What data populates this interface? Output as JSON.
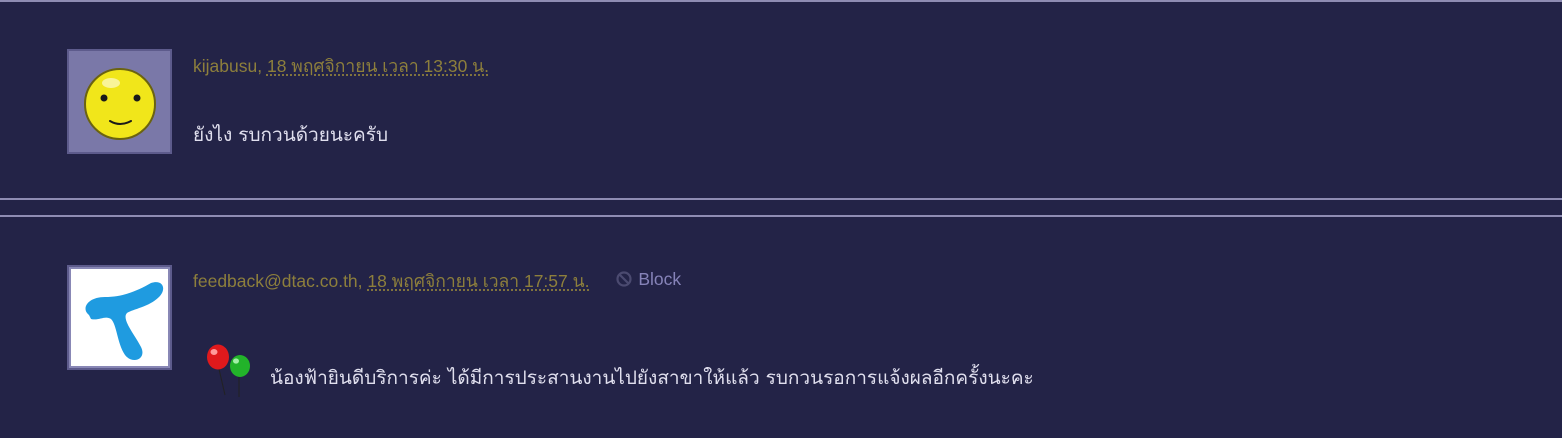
{
  "comments": [
    {
      "author": "kijabusu",
      "separator": ",",
      "timestamp": "18 พฤศจิกายน เวลา 13:30 น.",
      "avatar_icon": "smiley-face-icon",
      "text": "ยังไง รบกวนด้วยนะครับ"
    },
    {
      "author": "feedback@dtac.co.th",
      "separator": ",",
      "timestamp": "18 พฤศจิกายน เวลา 17:57 น.",
      "avatar_icon": "dtac-logo-icon",
      "block_label": "Block",
      "block_icon": "block-icon",
      "decor_icon": "balloons-icon",
      "text": "น้องฟ้ายินดีบริการค่ะ  ได้มีการประสานงานไปยังสาขาให้แล้ว  รบกวนรอการแจ้งผลอีกครั้งนะคะ"
    }
  ],
  "colors": {
    "background": "#232347",
    "divider": "#8e8cb3",
    "author": "#8d7f3c",
    "block": "#8683b8",
    "body_text": "#e0dfee"
  }
}
